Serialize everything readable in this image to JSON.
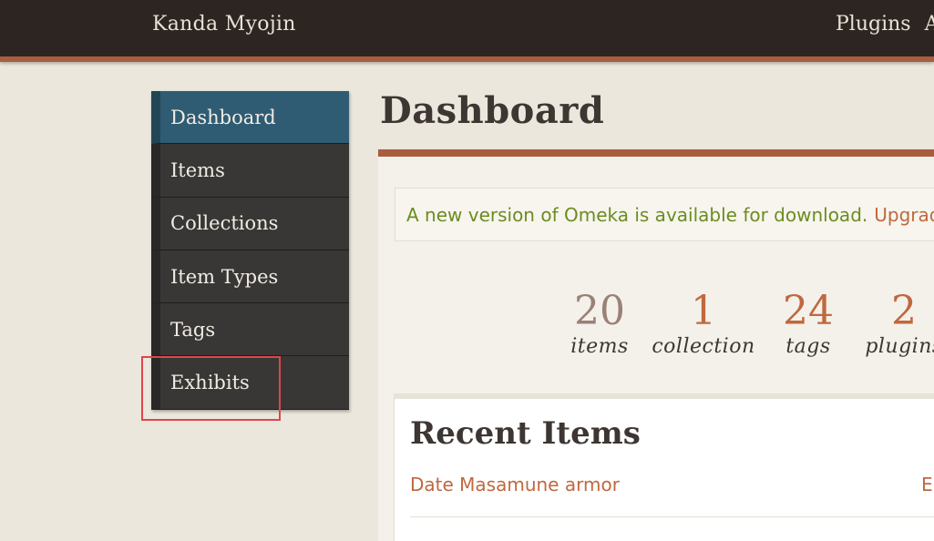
{
  "header": {
    "site_title": "Kanda Myojin",
    "nav": [
      "Plugins",
      "A"
    ]
  },
  "sidebar": {
    "items": [
      {
        "label": "Dashboard",
        "active": true
      },
      {
        "label": "Items"
      },
      {
        "label": "Collections"
      },
      {
        "label": "Item Types"
      },
      {
        "label": "Tags"
      },
      {
        "label": "Exhibits",
        "highlighted": true
      }
    ]
  },
  "main": {
    "title": "Dashboard",
    "notice": {
      "message": "A new version of Omeka is available for download.",
      "link": "Upgrade"
    },
    "stats": [
      {
        "value": "20",
        "label": "items"
      },
      {
        "value": "1",
        "label": "collection"
      },
      {
        "value": "24",
        "label": "tags"
      },
      {
        "value": "2",
        "label": "plugins"
      }
    ],
    "recent_items": {
      "title": "Recent Items",
      "items": [
        {
          "title": "Date Masamune armor",
          "action": "E"
        }
      ]
    }
  },
  "colors": {
    "header_bg": "#2c2521",
    "accent": "#a85d3e",
    "active_nav": "#2f5c73",
    "notice_text": "#6c8c21",
    "link": "#c0683f",
    "highlight": "#e0454c"
  }
}
